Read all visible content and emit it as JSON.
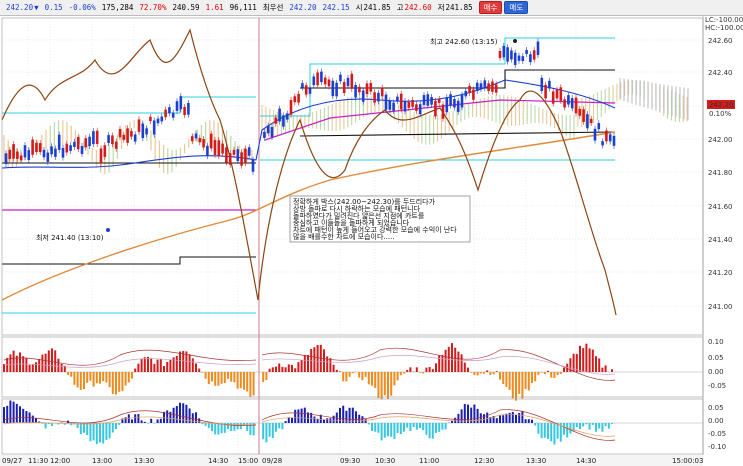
{
  "toolbar": {
    "price": "242.20",
    "arrow": "▼",
    "change": "0.15",
    "change_pct": "-0.06%",
    "volume": "175,284",
    "ratio": "72.70%",
    "v1": "240.59",
    "v2": "1.61",
    "v3": "96,111",
    "label1": "최우선",
    "bid": "242.20",
    "ask": "242.15",
    "open_label": "시",
    "open": "241.85",
    "high_label": "고",
    "high": "242.60",
    "low_label": "저",
    "low": "241.85",
    "buy_label": "매수",
    "sell_label": "매도"
  },
  "price_axis": {
    "ticks": [
      "242.60",
      "242.40",
      "242.20",
      "242.00",
      "241.80",
      "241.60",
      "241.40",
      "241.20",
      "241.00"
    ],
    "current_price": "242.20",
    "current_pct": "0.10%",
    "lc_label": "LC:-100.00",
    "hc_label": "HC:-100.00"
  },
  "osc1_axis": {
    "ticks": [
      "0.10",
      "0.05",
      "0.00",
      "-0.05"
    ]
  },
  "osc2_axis": {
    "ticks": [
      "0.05",
      "0.00",
      "-0.05",
      "-0.10"
    ]
  },
  "time_axis": {
    "labels": [
      "09/27",
      "11:30",
      "12:00",
      "13:00",
      "13:30",
      "14:30",
      "15:00",
      "09/28",
      "09:30",
      "10:30",
      "11:00",
      "12:30",
      "13:30",
      "14:30",
      "15:00:03"
    ]
  },
  "annotations": {
    "high_label": "최고 242.60 (13:15)",
    "low_label": "최저 241.40 (13:10)",
    "note_lines": [
      "정확하게 박스(242.00~242.30)를 두드리다가",
      "상방 돌파로 다시 하락하는 모습에 패턴니다",
      "돌파하였다가 밀려진다 얇은선 지점에 카트를",
      "중심하고 이들돌을 돌파하게 되었습니다",
      "차트에 패턴이 높게 들어오고 강력한 모습에 수익이 난다",
      "많을 배를수한 차트에 모습이다....."
    ]
  },
  "colors": {
    "up": "#d31b1b",
    "down": "#1a3fd1",
    "cyan": "#2ad1e0",
    "black": "#111111",
    "magenta": "#c81ec8",
    "brown": "#8b4513",
    "orange_ma": "#e08a3a",
    "osc_up": "#d31b1b",
    "osc_down": "#ef8a1d",
    "osc2_up": "#1a1fb0",
    "osc2_down": "#36c8e0",
    "separator": "#c05a6a"
  }
}
